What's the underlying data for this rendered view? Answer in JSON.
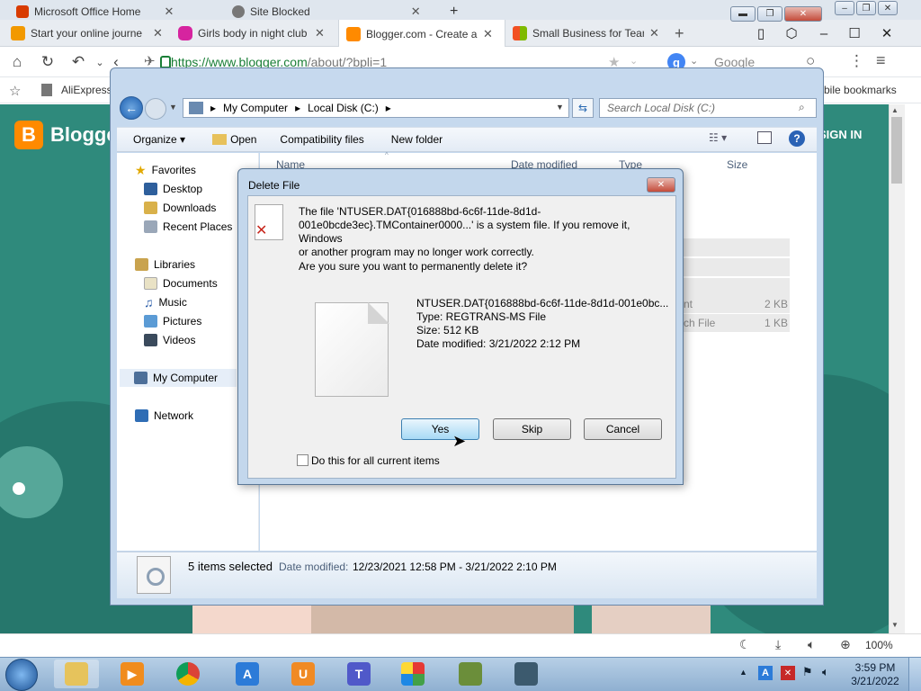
{
  "browser": {
    "back_tabs": [
      {
        "label": "Microsoft Office Home",
        "icon": "office-icon",
        "color": "#d83b01"
      },
      {
        "label": "Site Blocked",
        "icon": "globe-icon",
        "color": "#6b6b6b"
      }
    ],
    "tabs": [
      {
        "label": "Start your online journe",
        "icon": "tab-favicon-icon",
        "color": "#f29900"
      },
      {
        "label": "Girls body in night club",
        "icon": "instagram-icon",
        "color": "#d6249f"
      },
      {
        "label": "Blogger.com - Create a",
        "icon": "blogger-icon",
        "color": "#ff8a00"
      },
      {
        "label": "Small Business for Tean",
        "icon": "microsoft-icon",
        "color": "#00a4ef"
      }
    ],
    "url_host": "https://www.blogger.com",
    "url_path": "/about/?bpli=1",
    "search_engine": "Google",
    "bookmarks": [
      "AliExpress"
    ],
    "mobile_bookmarks": "bile bookmarks",
    "zoom": "100%"
  },
  "page": {
    "brand": "Blogger",
    "signin": "SIGN IN"
  },
  "explorer": {
    "breadcrumb": [
      "My Computer",
      "Local Disk (C:)"
    ],
    "search_placeholder": "Search Local Disk (C:)",
    "toolbar": {
      "organize": "Organize",
      "open": "Open",
      "compat": "Compatibility files",
      "new_folder": "New folder"
    },
    "nav": {
      "favorites": "Favorites",
      "desktop": "Desktop",
      "downloads": "Downloads",
      "recent": "Recent Places",
      "libraries": "Libraries",
      "documents": "Documents",
      "music": "Music",
      "pictures": "Pictures",
      "videos": "Videos",
      "my_computer": "My Computer",
      "network": "Network"
    },
    "columns": {
      "name": "Name",
      "date": "Date modified",
      "type": "Type",
      "size": "Size"
    },
    "rows": [
      {
        "type": "nt",
        "size": "2 KB"
      },
      {
        "type": "ch File",
        "size": "1 KB"
      }
    ],
    "details": {
      "selected": "5 items selected",
      "date_label": "Date modified:",
      "date_range": "12/23/2021 12:58 PM - 3/21/2022 2:10 PM"
    }
  },
  "dialog": {
    "title": "Delete File",
    "message_1": "The file 'NTUSER.DAT{016888bd-6c6f-11de-8d1d-",
    "message_2": "001e0bcde3ec}.TMContainer0000...' is a system file. If you remove it, Windows",
    "message_3": "or another program may no longer work correctly.",
    "question": "Are you sure you want to permanently delete it?",
    "file_name": "NTUSER.DAT{016888bd-6c6f-11de-8d1d-001e0bc...",
    "file_type": "Type: REGTRANS-MS File",
    "file_size": "Size: 512 KB",
    "file_date": "Date modified: 3/21/2022 2:12 PM",
    "yes": "Yes",
    "skip": "Skip",
    "cancel": "Cancel",
    "checkbox": "Do this for all current items"
  },
  "taskbar": {
    "time": "3:59 PM",
    "date": "3/21/2022"
  }
}
